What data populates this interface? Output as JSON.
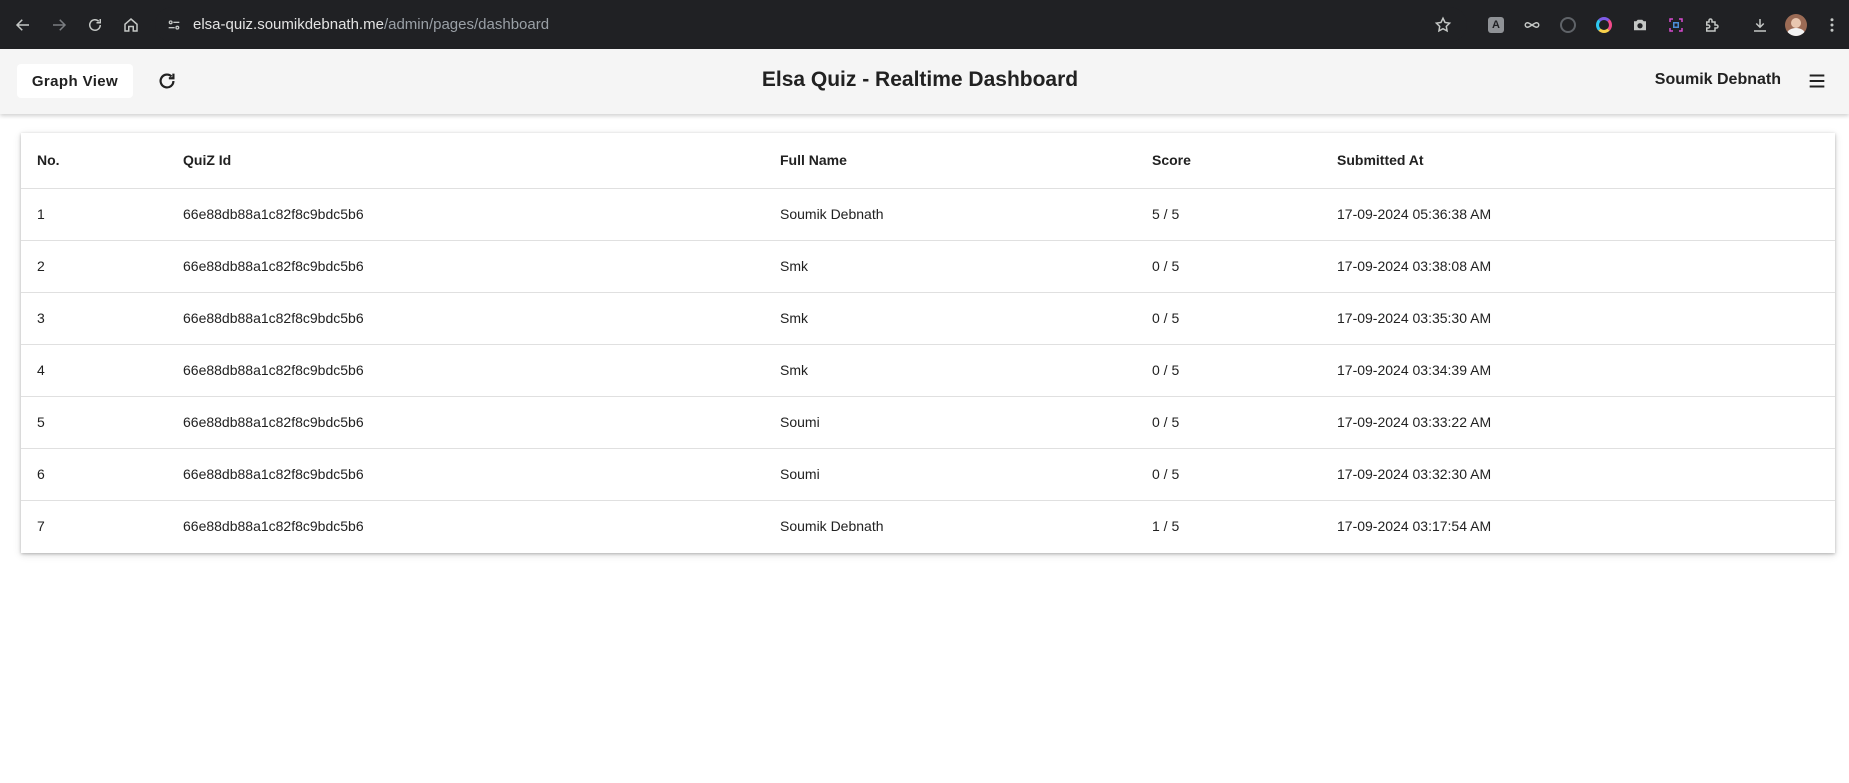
{
  "browser": {
    "url_host": "elsa-quiz.soumikdebnath.me",
    "url_path": "/admin/pages/dashboard",
    "extensions": [
      "translate-icon",
      "infinity-icon",
      "circle-icon",
      "color-picker-icon",
      "camera-icon",
      "screenshot-icon",
      "puzzle-icon"
    ]
  },
  "header": {
    "graph_view_label": "Graph View",
    "title": "Elsa Quiz - Realtime Dashboard",
    "user_name": "Soumik Debnath"
  },
  "table": {
    "columns": [
      "No.",
      "QuiZ Id",
      "Full Name",
      "Score",
      "Submitted At"
    ],
    "rows": [
      {
        "no": "1",
        "quiz_id": "66e88db88a1c82f8c9bdc5b6",
        "full_name": "Soumik Debnath",
        "score": "5 / 5",
        "submitted_at": "17-09-2024 05:36:38 AM"
      },
      {
        "no": "2",
        "quiz_id": "66e88db88a1c82f8c9bdc5b6",
        "full_name": "Smk",
        "score": "0 / 5",
        "submitted_at": "17-09-2024 03:38:08 AM"
      },
      {
        "no": "3",
        "quiz_id": "66e88db88a1c82f8c9bdc5b6",
        "full_name": "Smk",
        "score": "0 / 5",
        "submitted_at": "17-09-2024 03:35:30 AM"
      },
      {
        "no": "4",
        "quiz_id": "66e88db88a1c82f8c9bdc5b6",
        "full_name": "Smk",
        "score": "0 / 5",
        "submitted_at": "17-09-2024 03:34:39 AM"
      },
      {
        "no": "5",
        "quiz_id": "66e88db88a1c82f8c9bdc5b6",
        "full_name": "Soumi",
        "score": "0 / 5",
        "submitted_at": "17-09-2024 03:33:22 AM"
      },
      {
        "no": "6",
        "quiz_id": "66e88db88a1c82f8c9bdc5b6",
        "full_name": "Soumi",
        "score": "0 / 5",
        "submitted_at": "17-09-2024 03:32:30 AM"
      },
      {
        "no": "7",
        "quiz_id": "66e88db88a1c82f8c9bdc5b6",
        "full_name": "Soumik Debnath",
        "score": "1 / 5",
        "submitted_at": "17-09-2024 03:17:54 AM"
      }
    ]
  }
}
